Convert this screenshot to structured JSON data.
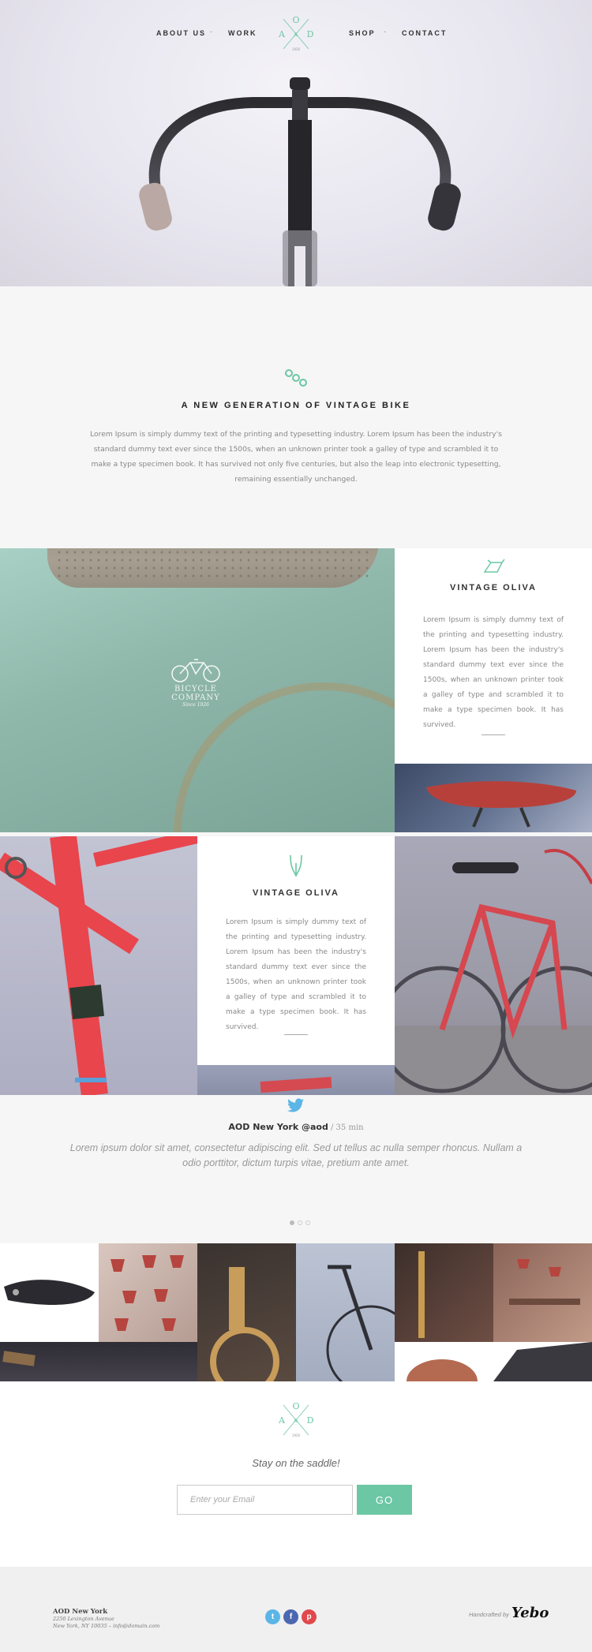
{
  "nav": {
    "items": [
      "ABOUT US",
      "WORK",
      "SHOP",
      "CONTACT"
    ],
    "separator": "-",
    "logo": {
      "top": "O",
      "left": "A",
      "right": "D",
      "mid": "&",
      "bottom": "1926"
    }
  },
  "intro": {
    "icon": "chain-icon",
    "title": "A NEW GENERATION OF VINTAGE BIKE",
    "text": "Lorem Ipsum is simply dummy text of the printing and typesetting industry. Lorem Ipsum has been the industry's standard dummy text ever since the 1500s, when an unknown printer took a galley of type and scrambled it to make a type specimen book. It has survived not only five centuries, but also the leap into electronic typesetting, remaining essentially unchanged."
  },
  "panel1": {
    "brand": {
      "line1": "BICYCLE",
      "line2": "COMPANY",
      "line3": "Since 1926"
    },
    "card": {
      "icon": "bike-frame-icon",
      "title": "VINTAGE OLIVA",
      "text": "Lorem Ipsum is simply dummy text of the printing and typesetting industry. Lorem Ipsum has been the industry's standard dummy text ever since the 1500s, when an unknown printer took a galley of type and scrambled it to make a type specimen book. It has survived."
    }
  },
  "panel2": {
    "card": {
      "icon": "fork-icon",
      "title": "VINTAGE OLIVA",
      "text": "Lorem Ipsum is simply dummy text of the printing and typesetting industry. Lorem Ipsum has been the industry's standard dummy text ever since the 1500s, when an unknown printer took a galley of type and scrambled it to make a type specimen book. It has survived."
    }
  },
  "tweet": {
    "icon": "twitter-icon",
    "handle": "AOD New York @aod",
    "time": " / 35 min",
    "text": "Lorem ipsum dolor sit amet, consectetur adipiscing elit. Sed ut tellus ac nulla semper rhoncus. Nullam a odio porttitor, dictum turpis vitae, pretium ante amet.",
    "dots": 3,
    "active": 0
  },
  "newsletter": {
    "tagline": "Stay on the saddle!",
    "placeholder": "Enter your Email",
    "button": "GO"
  },
  "footer": {
    "name": "AOD New York",
    "address1": "2250 Lexington Avenue",
    "address2": "New York, NY 10035 – info@domain.com",
    "social": [
      {
        "name": "twitter",
        "glyph": "t",
        "color": "#5bb5e6"
      },
      {
        "name": "facebook",
        "glyph": "f",
        "color": "#4b67b0"
      },
      {
        "name": "pinterest",
        "glyph": "p",
        "color": "#e0494c"
      }
    ],
    "credit": "Handcrafted by",
    "credit_brand": "Yebo"
  },
  "colors": {
    "accent": "#6cc7a4",
    "bg": "#f6f6f6"
  }
}
